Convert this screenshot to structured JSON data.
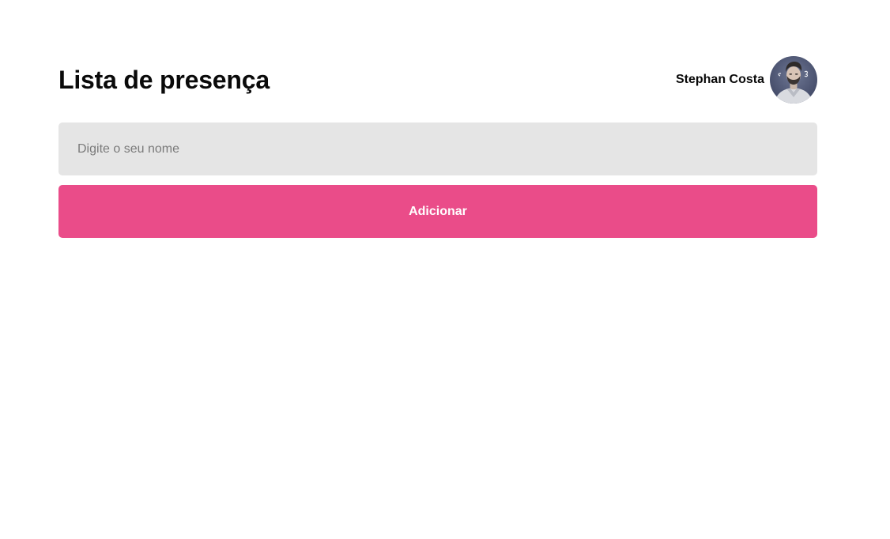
{
  "header": {
    "title": "Lista de presença"
  },
  "user": {
    "name": "Stephan Costa",
    "avatar_icon": "user-photo"
  },
  "form": {
    "name_placeholder": "Digite o seu nome",
    "name_value": "",
    "add_label": "Adicionar"
  },
  "colors": {
    "accent": "#ea4c89",
    "input_background": "#e5e5e5",
    "text": "#0a0a0a"
  }
}
